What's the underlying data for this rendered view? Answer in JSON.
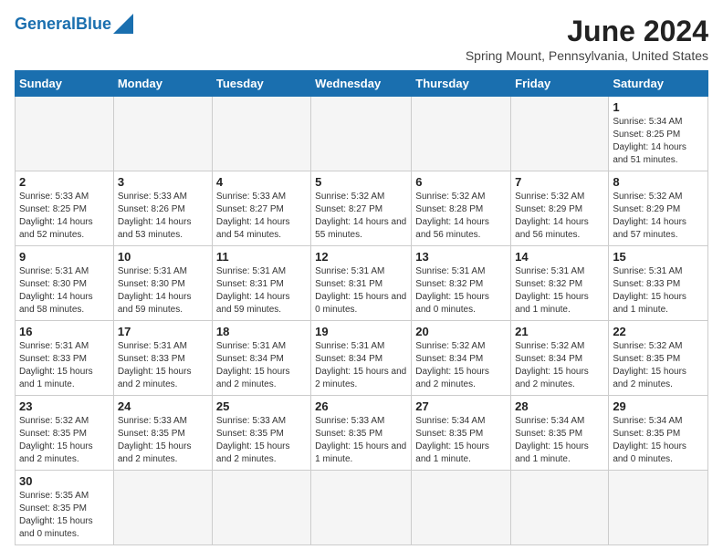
{
  "header": {
    "logo_general": "General",
    "logo_blue": "Blue",
    "title": "June 2024",
    "subtitle": "Spring Mount, Pennsylvania, United States"
  },
  "days_of_week": [
    "Sunday",
    "Monday",
    "Tuesday",
    "Wednesday",
    "Thursday",
    "Friday",
    "Saturday"
  ],
  "weeks": [
    [
      {
        "day": "",
        "info": ""
      },
      {
        "day": "",
        "info": ""
      },
      {
        "day": "",
        "info": ""
      },
      {
        "day": "",
        "info": ""
      },
      {
        "day": "",
        "info": ""
      },
      {
        "day": "",
        "info": ""
      },
      {
        "day": "1",
        "info": "Sunrise: 5:34 AM\nSunset: 8:25 PM\nDaylight: 14 hours and 51 minutes."
      }
    ],
    [
      {
        "day": "2",
        "info": "Sunrise: 5:33 AM\nSunset: 8:25 PM\nDaylight: 14 hours and 52 minutes."
      },
      {
        "day": "3",
        "info": "Sunrise: 5:33 AM\nSunset: 8:26 PM\nDaylight: 14 hours and 53 minutes."
      },
      {
        "day": "4",
        "info": "Sunrise: 5:33 AM\nSunset: 8:27 PM\nDaylight: 14 hours and 54 minutes."
      },
      {
        "day": "5",
        "info": "Sunrise: 5:32 AM\nSunset: 8:27 PM\nDaylight: 14 hours and 55 minutes."
      },
      {
        "day": "6",
        "info": "Sunrise: 5:32 AM\nSunset: 8:28 PM\nDaylight: 14 hours and 56 minutes."
      },
      {
        "day": "7",
        "info": "Sunrise: 5:32 AM\nSunset: 8:29 PM\nDaylight: 14 hours and 56 minutes."
      },
      {
        "day": "8",
        "info": "Sunrise: 5:32 AM\nSunset: 8:29 PM\nDaylight: 14 hours and 57 minutes."
      }
    ],
    [
      {
        "day": "9",
        "info": "Sunrise: 5:31 AM\nSunset: 8:30 PM\nDaylight: 14 hours and 58 minutes."
      },
      {
        "day": "10",
        "info": "Sunrise: 5:31 AM\nSunset: 8:30 PM\nDaylight: 14 hours and 59 minutes."
      },
      {
        "day": "11",
        "info": "Sunrise: 5:31 AM\nSunset: 8:31 PM\nDaylight: 14 hours and 59 minutes."
      },
      {
        "day": "12",
        "info": "Sunrise: 5:31 AM\nSunset: 8:31 PM\nDaylight: 15 hours and 0 minutes."
      },
      {
        "day": "13",
        "info": "Sunrise: 5:31 AM\nSunset: 8:32 PM\nDaylight: 15 hours and 0 minutes."
      },
      {
        "day": "14",
        "info": "Sunrise: 5:31 AM\nSunset: 8:32 PM\nDaylight: 15 hours and 1 minute."
      },
      {
        "day": "15",
        "info": "Sunrise: 5:31 AM\nSunset: 8:33 PM\nDaylight: 15 hours and 1 minute."
      }
    ],
    [
      {
        "day": "16",
        "info": "Sunrise: 5:31 AM\nSunset: 8:33 PM\nDaylight: 15 hours and 1 minute."
      },
      {
        "day": "17",
        "info": "Sunrise: 5:31 AM\nSunset: 8:33 PM\nDaylight: 15 hours and 2 minutes."
      },
      {
        "day": "18",
        "info": "Sunrise: 5:31 AM\nSunset: 8:34 PM\nDaylight: 15 hours and 2 minutes."
      },
      {
        "day": "19",
        "info": "Sunrise: 5:31 AM\nSunset: 8:34 PM\nDaylight: 15 hours and 2 minutes."
      },
      {
        "day": "20",
        "info": "Sunrise: 5:32 AM\nSunset: 8:34 PM\nDaylight: 15 hours and 2 minutes."
      },
      {
        "day": "21",
        "info": "Sunrise: 5:32 AM\nSunset: 8:34 PM\nDaylight: 15 hours and 2 minutes."
      },
      {
        "day": "22",
        "info": "Sunrise: 5:32 AM\nSunset: 8:35 PM\nDaylight: 15 hours and 2 minutes."
      }
    ],
    [
      {
        "day": "23",
        "info": "Sunrise: 5:32 AM\nSunset: 8:35 PM\nDaylight: 15 hours and 2 minutes."
      },
      {
        "day": "24",
        "info": "Sunrise: 5:33 AM\nSunset: 8:35 PM\nDaylight: 15 hours and 2 minutes."
      },
      {
        "day": "25",
        "info": "Sunrise: 5:33 AM\nSunset: 8:35 PM\nDaylight: 15 hours and 2 minutes."
      },
      {
        "day": "26",
        "info": "Sunrise: 5:33 AM\nSunset: 8:35 PM\nDaylight: 15 hours and 1 minute."
      },
      {
        "day": "27",
        "info": "Sunrise: 5:34 AM\nSunset: 8:35 PM\nDaylight: 15 hours and 1 minute."
      },
      {
        "day": "28",
        "info": "Sunrise: 5:34 AM\nSunset: 8:35 PM\nDaylight: 15 hours and 1 minute."
      },
      {
        "day": "29",
        "info": "Sunrise: 5:34 AM\nSunset: 8:35 PM\nDaylight: 15 hours and 0 minutes."
      }
    ],
    [
      {
        "day": "30",
        "info": "Sunrise: 5:35 AM\nSunset: 8:35 PM\nDaylight: 15 hours and 0 minutes."
      },
      {
        "day": "",
        "info": ""
      },
      {
        "day": "",
        "info": ""
      },
      {
        "day": "",
        "info": ""
      },
      {
        "day": "",
        "info": ""
      },
      {
        "day": "",
        "info": ""
      },
      {
        "day": "",
        "info": ""
      }
    ]
  ]
}
